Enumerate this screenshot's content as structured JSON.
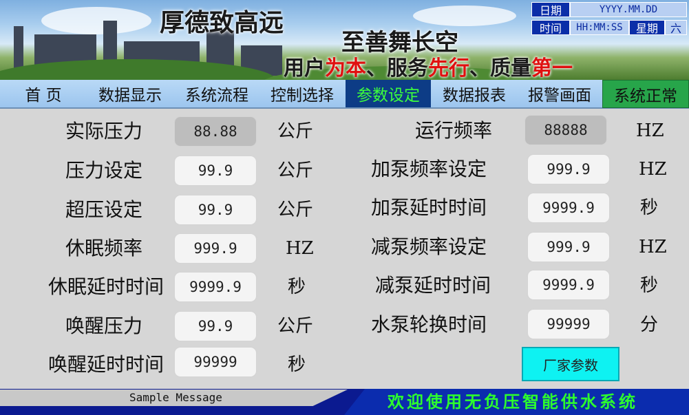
{
  "banner": {
    "slogan1": "厚德致高远",
    "slogan2": "至善舞长空",
    "slogan3": {
      "p1": "用户",
      "p2": "为本",
      "p3": "、服务",
      "p4": "先行",
      "p5": "、质量",
      "p6": "第一"
    }
  },
  "datetime": {
    "date_label": "日期",
    "date_value": "YYYY.MM.DD",
    "time_label": "时间",
    "time_value": "HH:MM:SS",
    "week_label": "星期",
    "week_value": "六"
  },
  "nav": {
    "items": [
      "首 页",
      "数据显示",
      "系统流程",
      "控制选择",
      "参数设定",
      "数据报表",
      "报警画面"
    ],
    "active_index": 4,
    "status": "系统正常"
  },
  "params_left": [
    {
      "label": "实际压力",
      "value": "88.88",
      "unit": "公斤",
      "readonly": true
    },
    {
      "label": "压力设定",
      "value": "99.9",
      "unit": "公斤"
    },
    {
      "label": "超压设定",
      "value": "99.9",
      "unit": "公斤"
    },
    {
      "label": "休眠频率",
      "value": "999.9",
      "unit": "HZ"
    },
    {
      "label": "休眠延时时间",
      "value": "9999.9",
      "unit": "秒"
    },
    {
      "label": "唤醒压力",
      "value": "99.9",
      "unit": "公斤"
    },
    {
      "label": "唤醒延时时间",
      "value": "99999",
      "unit": "秒"
    }
  ],
  "params_right": [
    {
      "label": "运行频率",
      "value": "88888",
      "unit": "HZ",
      "readonly": true
    },
    {
      "label": "加泵频率设定",
      "value": "999.9",
      "unit": "HZ"
    },
    {
      "label": "加泵延时时间",
      "value": "9999.9",
      "unit": "秒"
    },
    {
      "label": "减泵频率设定",
      "value": "999.9",
      "unit": "HZ"
    },
    {
      "label": "减泵延时时间",
      "value": "9999.9",
      "unit": "秒"
    },
    {
      "label": "水泵轮换时间",
      "value": "99999",
      "unit": "分"
    }
  ],
  "factory_button": "厂家参数",
  "footer": {
    "message": "Sample Message",
    "welcome": "欢迎使用无负压智能供水系统"
  },
  "colors": {
    "nav_active_bg": "#0d3c86",
    "nav_active_text": "#3cff3c",
    "status_ok": "#27a54a",
    "footer_bg": "#0b1a90",
    "factory_button": "#0ef2f2"
  }
}
